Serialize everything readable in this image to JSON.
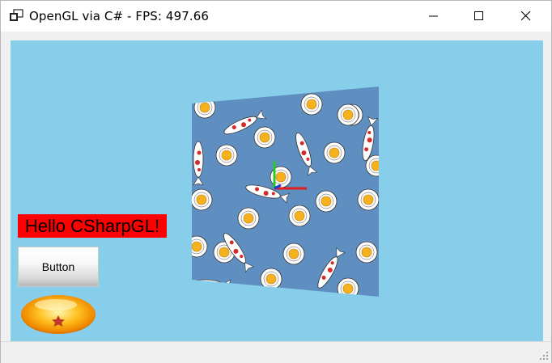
{
  "window": {
    "title": "OpenGL via C# - FPS: 497.66",
    "app_icon": "window-app-icon",
    "controls": {
      "minimize_icon": "minimize-icon",
      "maximize_icon": "maximize-icon",
      "close_icon": "close-icon"
    }
  },
  "scene": {
    "background_color": "#87ceea",
    "label": {
      "text": "Hello CSharpGL!",
      "background": "#ff0000"
    },
    "button": {
      "label": "Button"
    },
    "dragon_ball_icon": "dragon-ball-star-icon",
    "textured_quad": "koi-lotus-texture",
    "axes": [
      "x-axis-red",
      "y-axis-green",
      "z-axis-blue"
    ]
  },
  "statusbar": {
    "grip_icon": "resize-grip-icon"
  }
}
